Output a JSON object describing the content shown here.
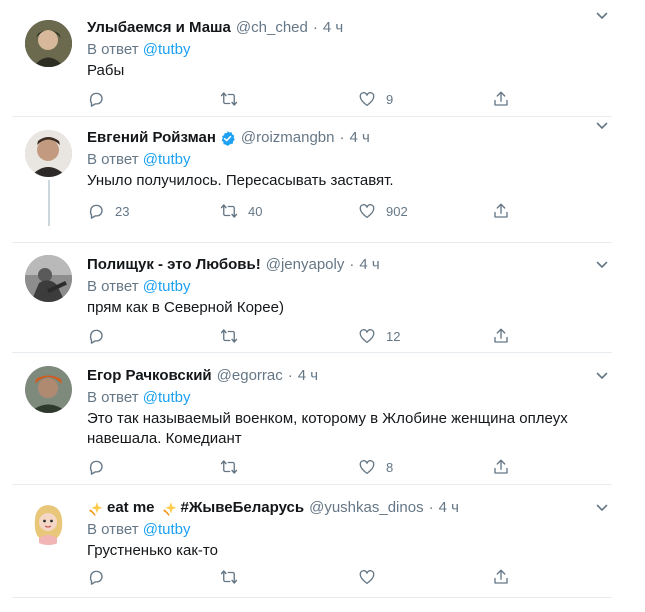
{
  "tweets": [
    {
      "name": "Улыбаемся и Маша",
      "handle": "@ch_ched",
      "sep": "·",
      "time": "4 ч",
      "reply_prefix": "В ответ",
      "reply_to": "@tutby",
      "text": "Рабы",
      "counts": {
        "reply": "",
        "retweet": "",
        "like": "9"
      }
    },
    {
      "name": "Евгений Ройзман",
      "verified": true,
      "handle": "@roizmangbn",
      "sep": "·",
      "time": "4 ч",
      "reply_prefix": "В ответ",
      "reply_to": "@tutby",
      "text": "Уныло получилось. Пересасывать заставят.",
      "counts": {
        "reply": "23",
        "retweet": "40",
        "like": "902"
      }
    },
    {
      "name": "Полищук - это Любовь!",
      "handle": "@jenyapoly",
      "sep": "·",
      "time": "4 ч",
      "reply_prefix": "В ответ",
      "reply_to": "@tutby",
      "text": "прям как в Северной Корее)",
      "counts": {
        "reply": "",
        "retweet": "",
        "like": "12"
      }
    },
    {
      "name": "Егор Рачковский",
      "handle": "@egorrac",
      "sep": "·",
      "time": "4 ч",
      "reply_prefix": "В ответ",
      "reply_to": "@tutby",
      "text": "Это так называемый военком, которому в Жлобине женщина оплеух навешала. Комедиант",
      "counts": {
        "reply": "",
        "retweet": "",
        "like": "8"
      }
    },
    {
      "name_part1": "eat me",
      "name_part2": "#ЖывеБеларусь",
      "handle": "@yushkas_dinos",
      "sep": "·",
      "time": "4 ч",
      "reply_prefix": "В ответ",
      "reply_to": "@tutby",
      "text": "Грустненько как-то",
      "counts": {
        "reply": "",
        "retweet": "",
        "like": ""
      }
    }
  ],
  "colors": {
    "accent": "#1da1f2",
    "muted": "#657786",
    "border": "#e6ecf0",
    "verified": "#1da1f2"
  },
  "icons": [
    "reply-icon",
    "retweet-icon",
    "like-icon",
    "share-icon",
    "caret-down-icon",
    "verified-badge-icon",
    "sparkle-icon"
  ]
}
